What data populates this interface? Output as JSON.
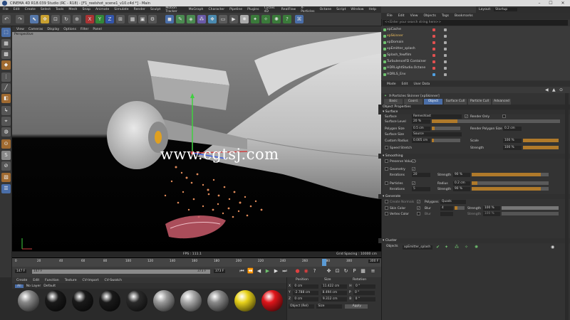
{
  "titlebar": {
    "title": "CINEMA 4D R18.039 Studio (RC - R18) - [F1_reelshot_scene1_v10.c4d *] - Main",
    "minimize": "–",
    "maximize": "☐",
    "close": "✕"
  },
  "menubar": [
    "File",
    "Edit",
    "Create",
    "Select",
    "Tools",
    "Mesh",
    "Snap",
    "Animate",
    "Simulate",
    "Render",
    "Sculpt",
    "Motion Tracker",
    "MoGraph",
    "Character",
    "Pipeline",
    "Plugins",
    "Cycles 4D",
    "RealFlow",
    "X-Particles",
    "Octane",
    "Script",
    "Window",
    "Help"
  ],
  "layout": {
    "label": "Layout:",
    "value": "Startup"
  },
  "viewport": {
    "menu": [
      "View",
      "Cameras",
      "Display",
      "Options",
      "Filter",
      "Panel"
    ],
    "label": "Perspective",
    "watermark": "www.cgtsj.com",
    "fps": "FPS : 111.1",
    "grid": "Grid Spacing : 10000 cm"
  },
  "timeline": {
    "ticks": [
      "0",
      "20",
      "40",
      "60",
      "80",
      "100",
      "120",
      "140",
      "160",
      "180",
      "200",
      "220",
      "240",
      "260",
      "280",
      "300"
    ],
    "current": "1 F",
    "end": "300 F"
  },
  "transport": {
    "start": "147 F",
    "field1": "147 F",
    "field2": "373 F",
    "end": "373 F"
  },
  "materials": {
    "menu": [
      "Create",
      "Edit",
      "Function",
      "Texture",
      "CV-Import",
      "CV-Swatch"
    ],
    "filters": [
      "All",
      "No Layer",
      "Default"
    ],
    "items": [
      {
        "name": "Mat",
        "color": "#888888"
      },
      {
        "name": "Mat.1",
        "color": "#1a1a1a"
      },
      {
        "name": "Mat.2",
        "color": "#1a1a1a"
      },
      {
        "name": "Mat.3",
        "color": "#1a1a1a"
      },
      {
        "name": "Mat.4",
        "color": "#2a2a2a"
      },
      {
        "name": "Mat.5",
        "color": "#9a9a9a"
      },
      {
        "name": "Mat.6",
        "color": "#aaaaaa"
      },
      {
        "name": "Mat.7",
        "color": "#8a8a8a"
      },
      {
        "name": "Mat.8",
        "color": "#e8d21a"
      },
      {
        "name": "Mat.9",
        "color": "#e0151a"
      }
    ]
  },
  "coords": {
    "headers": [
      "Position",
      "Size",
      "Rotation"
    ],
    "rows": [
      {
        "axis": "X",
        "pos": "0 cm",
        "size": "11.422 cm",
        "rotlbl": "H",
        "rot": "0 °"
      },
      {
        "axis": "Y",
        "pos": "-2.788 cm",
        "size": "8.494 cm",
        "rotlbl": "P",
        "rot": "0 °"
      },
      {
        "axis": "Z",
        "pos": "0 cm",
        "size": "9.312 cm",
        "rotlbl": "B",
        "rot": "0 °"
      }
    ],
    "mode": "Object (Rel)",
    "sizemode": "Size",
    "apply": "Apply"
  },
  "objects": {
    "menu": [
      "File",
      "Edit",
      "View",
      "Objects",
      "Tags",
      "Bookmarks"
    ],
    "search": "<<Enter your search string here>>",
    "rows": [
      {
        "name": "xpCache",
        "color": "#e05050"
      },
      {
        "name": "xpSkinner",
        "color": "#e05050",
        "selected": true
      },
      {
        "name": "xpDomain",
        "color": "#e05050"
      },
      {
        "name": "xpEmitter_splash",
        "color": "#e05050"
      },
      {
        "name": "Splash_fewfilm",
        "color": "#e05050"
      },
      {
        "name": "TurbulenceFD Container",
        "color": "#e05050"
      },
      {
        "name": "HDRLightStudio.Octane",
        "color": "#e05050"
      },
      {
        "name": "HDRLS_Env",
        "color": "#50a0e0"
      }
    ]
  },
  "attributes": {
    "menu": [
      "Mode",
      "Edit",
      "User Data"
    ],
    "title": "X-Particles Skinner [xpSkinner]",
    "tabs": [
      "Basic",
      "Coord.",
      "Object",
      "Surface Cull",
      "Particle Cull",
      "Advanced"
    ],
    "activeTab": "Object",
    "sectionProps": "Object Properties",
    "sectionSurface": "▾ Surface",
    "surface": {
      "label": "Surface",
      "value": "Remeshlast",
      "renderonly": "Render Only"
    },
    "surfacelevel": {
      "label": "Surface Level",
      "value": "20 %",
      "pct": 0.2
    },
    "polysize": {
      "label": "Polygon Size",
      "value": "0.5 cm",
      "rlabel": "Render Polygon Size",
      "rvalue": "0.2 cm"
    },
    "surfacesize": {
      "label": "Surface Size",
      "value": "Source"
    },
    "customradius": {
      "label": "Custom Radius",
      "value": "0.005 cm",
      "slabel": "Scale",
      "svalue": "100 %"
    },
    "speedstretch": {
      "label": "Speed Stretch",
      "strlabel": "Strength",
      "strvalue": "100 %"
    },
    "sectionSmoothing": "▾ Smoothing",
    "preservevolume": {
      "label": "Preserve Volume"
    },
    "geometry": {
      "label": "Geometry"
    },
    "iterations1": {
      "label": "Iterations",
      "value": "20",
      "slabel": "Strength",
      "svalue": "90 %"
    },
    "particles": {
      "label": "Particles",
      "rlabel": "Radius",
      "rvalue": "0.2 cm"
    },
    "iterations2": {
      "label": "Iterations",
      "value": "5",
      "slabel": "Strength",
      "svalue": "90 %"
    },
    "sectionGenerate": "▾ Generate",
    "createnormals": {
      "label": "Create Normals",
      "polylabel": "Polygons",
      "polyvalue": "Quads"
    },
    "skincolor": {
      "label": "Skin Color",
      "blurlabel": "Blur",
      "blurvalue": "4",
      "slabel": "Strength",
      "svalue": "100 %"
    },
    "vertexcolor": {
      "label": "Vertex Color",
      "blurlabel": "Blur",
      "blurvalue": "",
      "slabel": "Strength",
      "svalue": "100 %"
    },
    "sectionCluster": "▾ Cluster",
    "objectslabel": "Objects",
    "objectsvalue": "xpEmitter_splash"
  }
}
